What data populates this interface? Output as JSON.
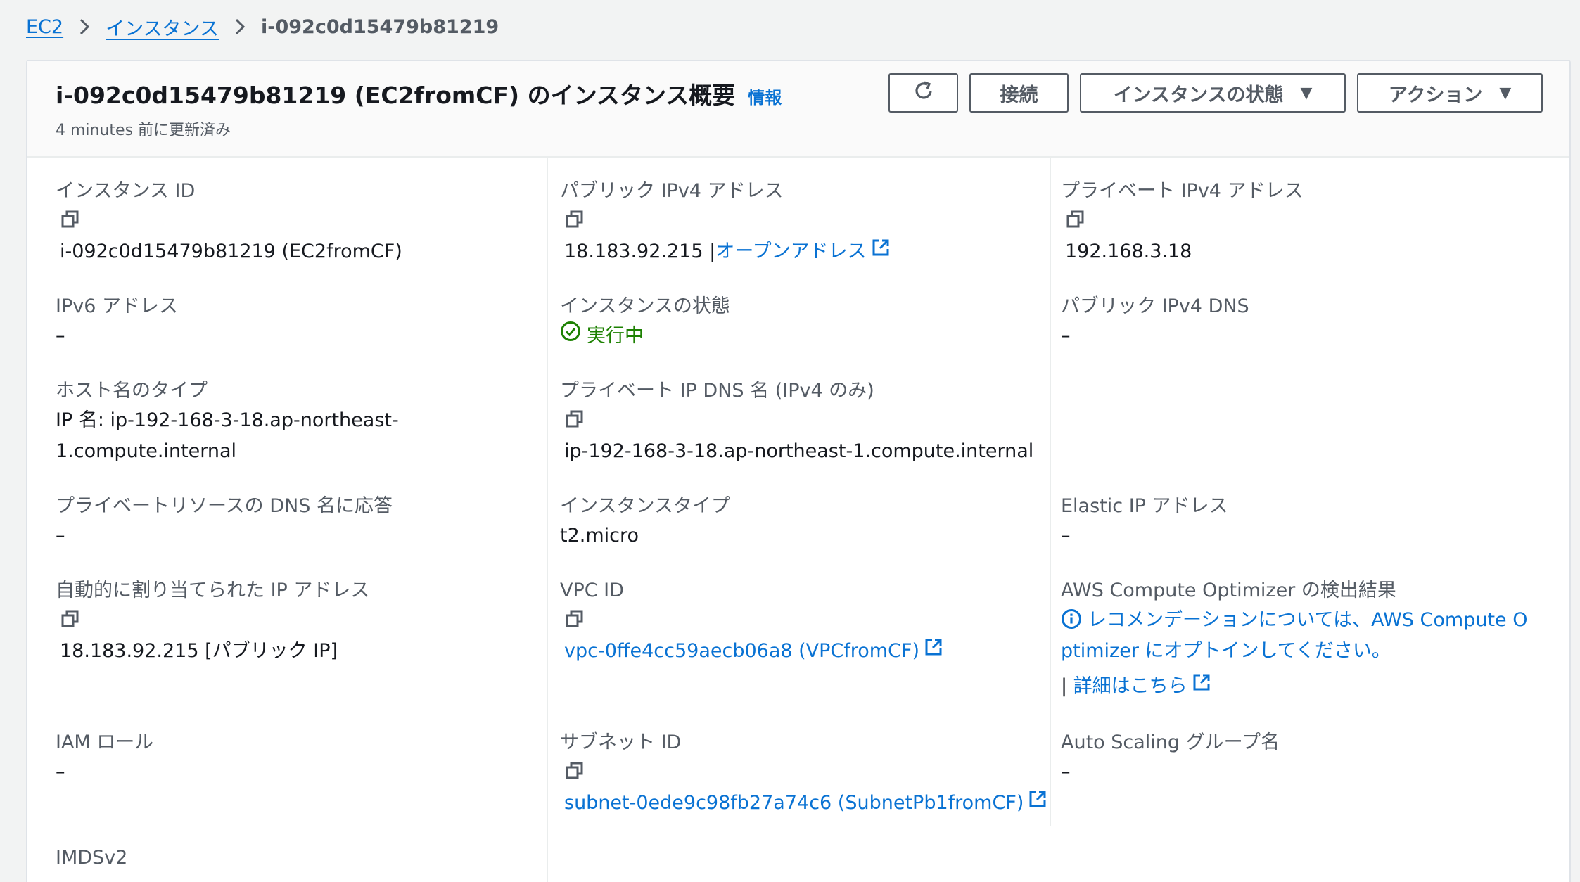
{
  "breadcrumb": {
    "items": [
      "EC2",
      "インスタンス"
    ],
    "current": "i-092c0d15479b81219"
  },
  "header": {
    "title": "i-092c0d15479b81219 (EC2fromCF) のインスタンス概要",
    "info_link": "情報",
    "updated": "4 minutes 前に更新済み",
    "buttons": {
      "connect": "接続",
      "instance_state": "インスタンスの状態",
      "actions": "アクション"
    }
  },
  "fields": {
    "instance_id": {
      "label": "インスタンス ID",
      "value": "i-092c0d15479b81219 (EC2fromCF)"
    },
    "public_ipv4": {
      "label": "パブリック IPv4 アドレス",
      "value": "18.183.92.215 |",
      "link": "オープンアドレス"
    },
    "private_ipv4": {
      "label": "プライベート IPv4 アドレス",
      "value": "192.168.3.18"
    },
    "ipv6": {
      "label": "IPv6 アドレス",
      "value": "–"
    },
    "instance_state": {
      "label": "インスタンスの状態",
      "value": "実行中"
    },
    "public_dns": {
      "label": "パブリック IPv4 DNS",
      "value": "–"
    },
    "hostname_type": {
      "label": "ホスト名のタイプ",
      "value_line1": "IP 名: ip-192-168-3-18.ap-northeast-",
      "value_line2": "1.compute.internal"
    },
    "private_dns": {
      "label": "プライベート IP DNS 名 (IPv4 のみ)",
      "value": "ip-192-168-3-18.ap-northeast-1.compute.internal"
    },
    "private_resource_dns": {
      "label": "プライベートリソースの DNS 名に応答",
      "value": "–"
    },
    "instance_type": {
      "label": "インスタンスタイプ",
      "value": "t2.micro"
    },
    "elastic_ip": {
      "label": "Elastic IP アドレス",
      "value": "–"
    },
    "auto_ip": {
      "label": "自動的に割り当てられた IP アドレス",
      "value": "18.183.92.215 [パブリック IP]"
    },
    "vpc_id": {
      "label": "VPC ID",
      "value": "vpc-0ffe4cc59aecb06a8 (VPCfromCF)"
    },
    "optimizer": {
      "label": "AWS Compute Optimizer の検出結果",
      "message_line1": "レコメンデーションについては、AWS Compute O",
      "message_line2": "ptimizer にオプトインしてください。",
      "details_link": "詳細はこちら"
    },
    "iam_role": {
      "label": "IAM ロール",
      "value": "–"
    },
    "subnet_id": {
      "label": "サブネット ID",
      "value": "subnet-0ede9c98fb27a74c6 (SubnetPb1fromCF)"
    },
    "auto_scaling": {
      "label": "Auto Scaling グループ名",
      "value": "–"
    },
    "imdsv2": {
      "label": "IMDSv2"
    }
  },
  "colors": {
    "link": "#0972d3",
    "success": "#1d8102",
    "label": "#545b64",
    "text": "#16191f"
  }
}
